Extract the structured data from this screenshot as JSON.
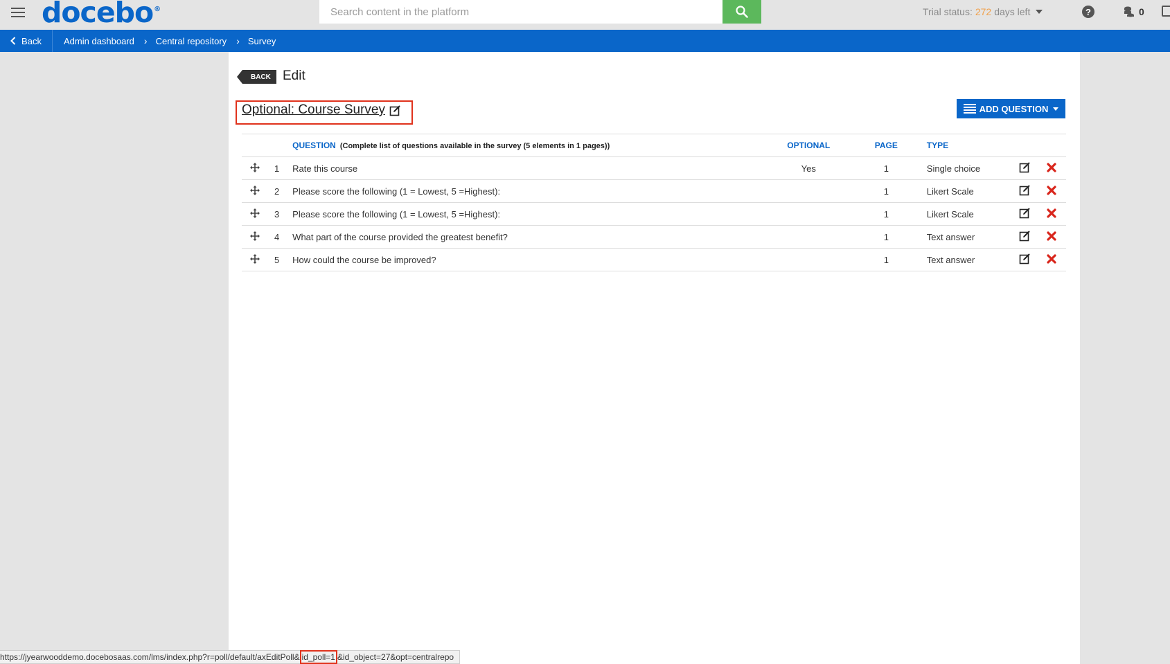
{
  "header": {
    "logo_text": "docebo",
    "logo_mark": "®",
    "search_placeholder": "Search content in the platform",
    "trial_prefix": "Trial status:",
    "trial_days": "272",
    "trial_suffix": "days left",
    "coins_count": "0",
    "help_glyph": "?"
  },
  "breadcrumb": {
    "back_label": "Back",
    "items": [
      "Admin dashboard",
      "Central repository",
      "Survey"
    ],
    "separator": "›"
  },
  "page": {
    "back_tag": "BACK",
    "title": "Edit",
    "survey_title": "Optional: Course Survey",
    "add_question_label": "ADD QUESTION"
  },
  "table": {
    "headers": {
      "question": "QUESTION",
      "question_note": "(Complete list of questions available in the survey (5 elements in 1 pages))",
      "optional": "OPTIONAL",
      "page": "PAGE",
      "type": "TYPE"
    },
    "rows": [
      {
        "num": "1",
        "question": "Rate this course",
        "optional": "Yes",
        "page": "1",
        "type": "Single choice"
      },
      {
        "num": "2",
        "question": "Please score the following (1 = Lowest, 5 =Highest):",
        "optional": "",
        "page": "1",
        "type": "Likert Scale"
      },
      {
        "num": "3",
        "question": "Please score the following (1 = Lowest, 5 =Highest):",
        "optional": "",
        "page": "1",
        "type": "Likert Scale"
      },
      {
        "num": "4",
        "question": "What part of the course provided the greatest benefit?",
        "optional": "",
        "page": "1",
        "type": "Text answer"
      },
      {
        "num": "5",
        "question": "How could the course be improved?",
        "optional": "",
        "page": "1",
        "type": "Text answer"
      }
    ]
  },
  "statusbar": {
    "url_prefix": "https://jyearwooddemo.docebosaas.com/lms/index.php?r=poll/default/axEditPoll&",
    "url_highlight": "id_poll=1",
    "url_suffix": "&id_object=27&opt=centralrepo"
  },
  "colors": {
    "brand_blue": "#0a66c9",
    "search_green": "#5cb85c",
    "delete_red": "#d9261c",
    "trial_orange": "#f0a04b",
    "highlight_red": "#e0321c"
  }
}
